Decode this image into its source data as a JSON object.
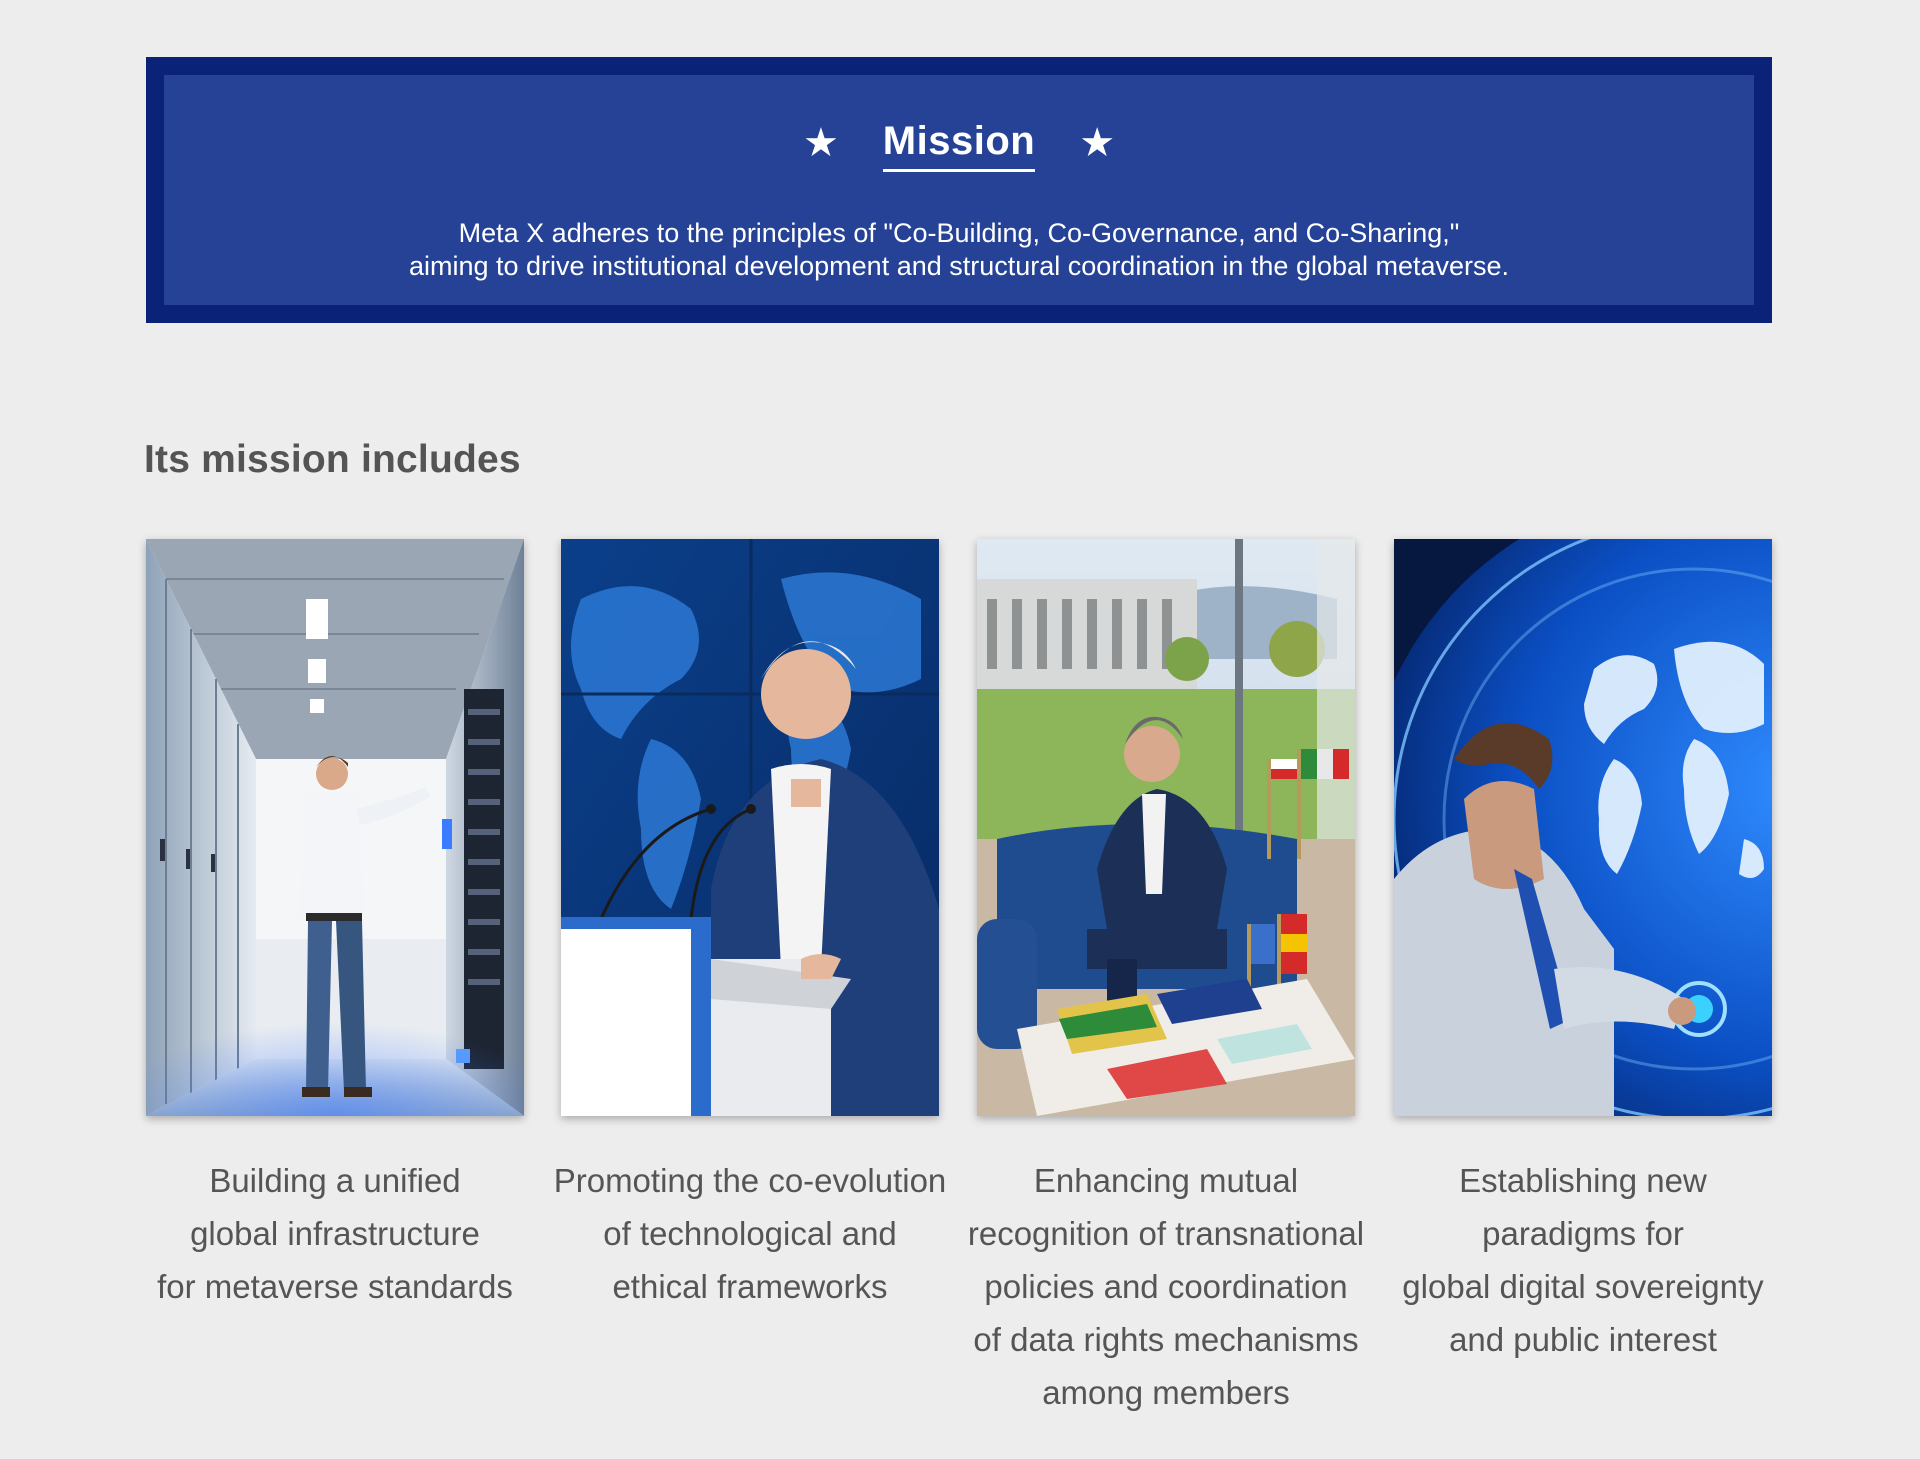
{
  "mission": {
    "title": "Mission",
    "lines": [
      "Meta X adheres to the principles of \"Co-Building, Co-Governance, and Co-Sharing,\"",
      "aiming to drive institutional development and structural coordination in the global metaverse."
    ],
    "star_glyph": "★"
  },
  "section": {
    "heading": "Its mission includes"
  },
  "cards": [
    {
      "caption_lines": [
        "Building a unified",
        "global infrastructure",
        "for metaverse standards"
      ]
    },
    {
      "caption_lines": [
        "Promoting the co-evolution",
        "of technological and",
        "ethical frameworks"
      ]
    },
    {
      "caption_lines": [
        "Enhancing mutual",
        "recognition of transnational",
        "policies and coordination",
        "of data rights mechanisms",
        "among members"
      ]
    },
    {
      "caption_lines": [
        "Establishing new",
        "paradigms for",
        "global digital sovereignty",
        "and public interest"
      ]
    }
  ],
  "colors": {
    "banner_outer": "#0a2378",
    "banner_inner": "#254296",
    "page_background": "#ededed",
    "caption_text": "#555555"
  }
}
